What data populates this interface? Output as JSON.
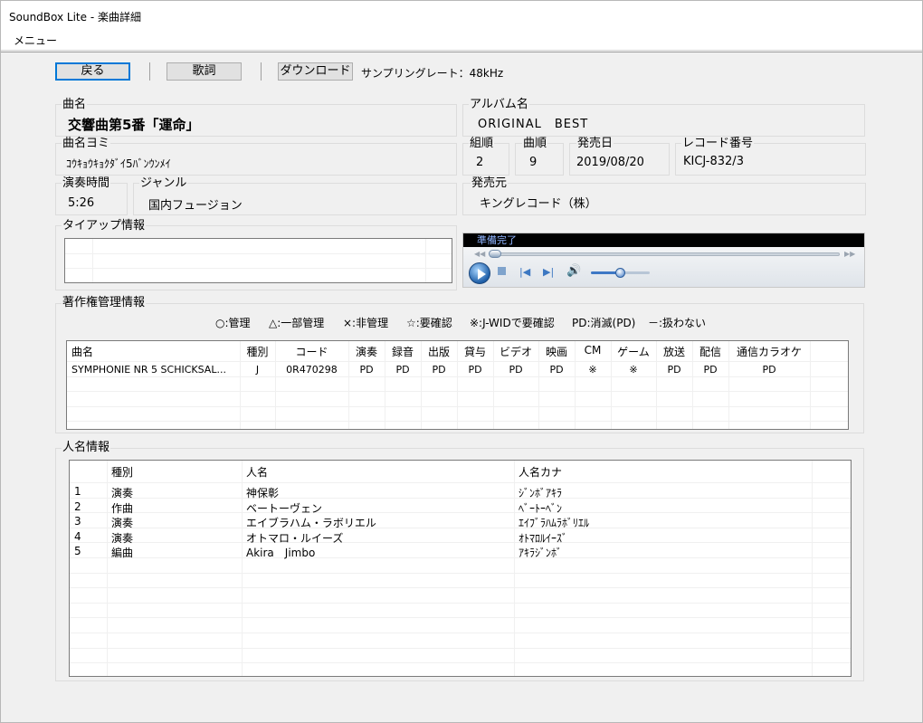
{
  "window": {
    "title": "SoundBox Lite - 楽曲詳細"
  },
  "menu": {
    "label": "メニュー"
  },
  "toolbar": {
    "back_label": "戻る",
    "lyrics_label": "歌詞",
    "download_label": "ダウンロード",
    "sampling_rate": "サンプリングレート：48kHz"
  },
  "song": {
    "title_label": "曲名",
    "title": "交響曲第5番「運命」",
    "reading_label": "曲名ヨミ",
    "reading": "ｺｳｷｮｳｷｮｸﾀﾞｲ5ﾊﾞﾝｳﾝﾒｲ",
    "album_label": "アルバム名",
    "album": "ORIGINAL　BEST",
    "disc_label": "組順",
    "disc": "2",
    "track_label": "曲順",
    "track": "9",
    "release_label": "発売日",
    "release": "2019/08/20",
    "record_no_label": "レコード番号",
    "record_no": "KICJ-832/3",
    "duration_label": "演奏時間",
    "duration": "5:26",
    "genre_label": "ジャンル",
    "genre": "国内フュージョン",
    "publisher_label": "発売元",
    "publisher": "キングレコード（株）",
    "tieup_label": "タイアップ情報"
  },
  "player": {
    "status": "準備完了",
    "volume": 0.5,
    "position": 0.0,
    "icons": [
      "rewind-icon",
      "fast-forward-icon",
      "play-icon",
      "stop-icon",
      "previous-icon",
      "next-icon",
      "volume-icon"
    ]
  },
  "copyright": {
    "label": "著作権管理情報",
    "legend": [
      "○:管理",
      "△:一部管理",
      "×:非管理",
      "☆:要確認",
      "※:J-WIDで要確認",
      "PD:消滅(PD)",
      "－:扱わない"
    ],
    "columns": [
      "曲名",
      "種別",
      "コード",
      "演奏",
      "録音",
      "出版",
      "貸与",
      "ビデオ",
      "映画",
      "CM",
      "ゲーム",
      "放送",
      "配信",
      "通信カラオケ"
    ],
    "rows": [
      [
        "SYMPHONIE NR 5 SCHICKSAL...",
        "J",
        "0R470298",
        "PD",
        "PD",
        "PD",
        "PD",
        "PD",
        "PD",
        "※",
        "※",
        "PD",
        "PD",
        "PD"
      ]
    ]
  },
  "persons": {
    "label": "人名情報",
    "columns": [
      "",
      "種別",
      "人名",
      "人名カナ"
    ],
    "rows": [
      [
        "1",
        "演奏",
        "神保彰",
        "ｼﾞﾝﾎﾞｱｷﾗ"
      ],
      [
        "2",
        "作曲",
        "ベートーヴェン",
        "ﾍﾞｰﾄｰﾍﾞﾝ"
      ],
      [
        "3",
        "演奏",
        "エイブラハム・ラボリエル",
        "ｴｲﾌﾞﾗﾊﾑﾗﾎﾞﾘｴﾙ"
      ],
      [
        "4",
        "演奏",
        "オトマロ・ルイーズ",
        "ｵﾄﾏﾛﾙｲｰｽﾞ"
      ],
      [
        "5",
        "編曲",
        "Akira　Jimbo",
        "ｱｷﾗｼﾞﾝﾎﾞ"
      ]
    ]
  }
}
